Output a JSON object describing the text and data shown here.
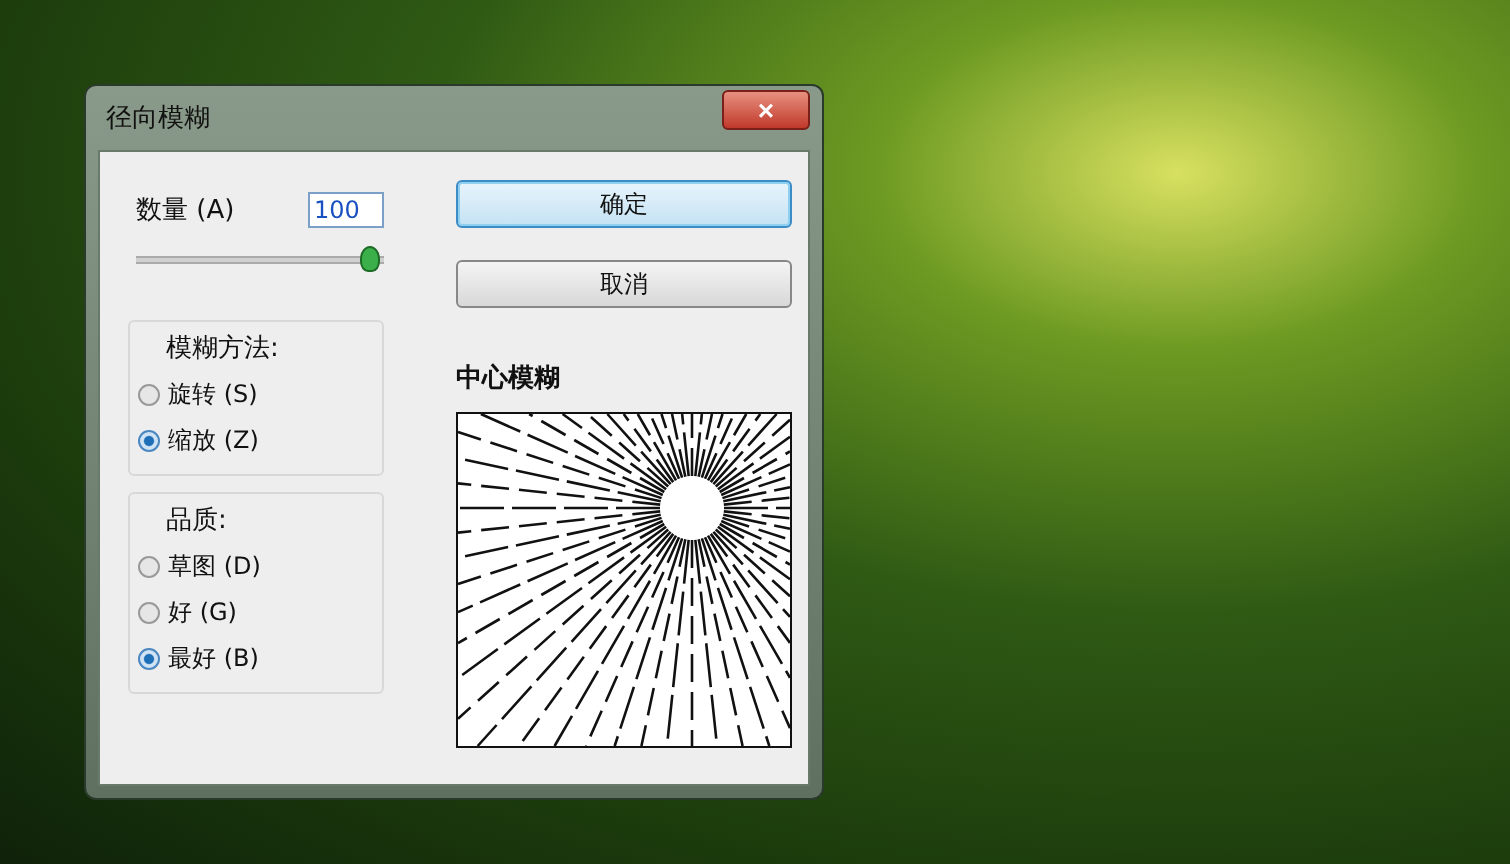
{
  "window": {
    "title": "径向模糊",
    "close": "×"
  },
  "amount": {
    "label": "数量 (A)",
    "value": "100",
    "level": 0.98
  },
  "buttons": [
    {
      "label": "确定",
      "default": true
    },
    {
      "label": "取消",
      "default": false
    }
  ],
  "blur_method": {
    "title": "模糊方法:",
    "options": [
      {
        "label": "旋转 (S)",
        "selected": false
      },
      {
        "label": "缩放 (Z)",
        "selected": true
      }
    ]
  },
  "quality": {
    "title": "品质:",
    "options": [
      {
        "label": "草图 (D)",
        "selected": false
      },
      {
        "label": "好 (G)",
        "selected": false
      },
      {
        "label": "最好 (B)",
        "selected": true
      }
    ]
  },
  "center": {
    "title": "中心模糊"
  }
}
